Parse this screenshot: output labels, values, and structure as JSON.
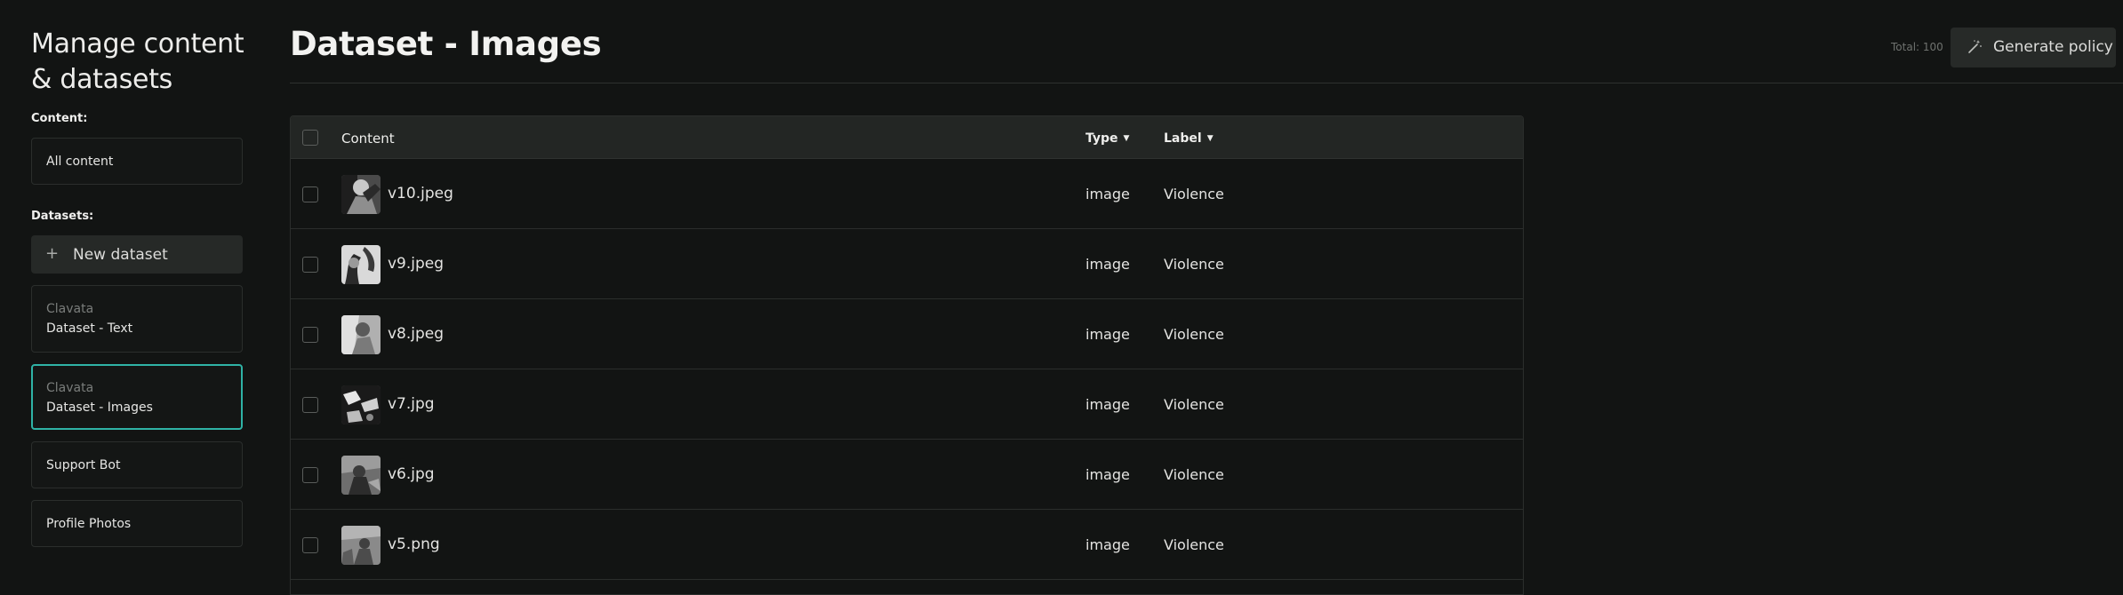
{
  "sidebar": {
    "title_line1": "Manage content",
    "title_line2": "& datasets",
    "content_label": "Content:",
    "all_content": "All content",
    "datasets_label": "Datasets:",
    "new_dataset_label": "New dataset",
    "datasets": [
      {
        "org": "Clavata",
        "name": "Dataset - Text"
      },
      {
        "org": "Clavata",
        "name": "Dataset - Images"
      },
      {
        "name": "Support Bot"
      },
      {
        "name": "Profile Photos"
      }
    ]
  },
  "header": {
    "title": "Dataset - Images",
    "total": "Total: 100",
    "generate_label": "Generate policy"
  },
  "table": {
    "columns": {
      "content": "Content",
      "type": "Type",
      "label": "Label"
    },
    "rows": [
      {
        "name": "v10.jpeg",
        "type": "image",
        "label": "Violence"
      },
      {
        "name": "v9.jpeg",
        "type": "image",
        "label": "Violence"
      },
      {
        "name": "v8.jpeg",
        "type": "image",
        "label": "Violence"
      },
      {
        "name": "v7.jpg",
        "type": "image",
        "label": "Violence"
      },
      {
        "name": "v6.jpg",
        "type": "image",
        "label": "Violence"
      },
      {
        "name": "v5.png",
        "type": "image",
        "label": "Violence"
      }
    ]
  },
  "icons": {
    "add": "plus-icon",
    "generate": "magic-wand-icon",
    "sort": "caret-down-icon"
  },
  "colors": {
    "accent": "#2fb3a6",
    "background": "#121413"
  }
}
